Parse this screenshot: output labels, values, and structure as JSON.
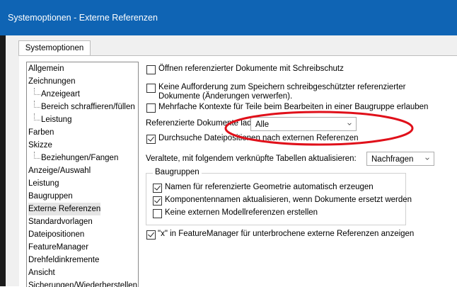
{
  "window": {
    "title": "Systemoptionen - Externe Referenzen"
  },
  "tabs": [
    {
      "label": "Systemoptionen"
    }
  ],
  "tree": {
    "items": [
      {
        "label": "Allgemein"
      },
      {
        "label": "Zeichnungen"
      },
      {
        "label": "Anzeigeart"
      },
      {
        "label": "Bereich schraffieren/füllen"
      },
      {
        "label": "Leistung"
      },
      {
        "label": "Farben"
      },
      {
        "label": "Skizze"
      },
      {
        "label": "Beziehungen/Fangen"
      },
      {
        "label": "Anzeige/Auswahl"
      },
      {
        "label": "Leistung"
      },
      {
        "label": "Baugruppen"
      },
      {
        "label": "Externe Referenzen"
      },
      {
        "label": "Standardvorlagen"
      },
      {
        "label": "Dateipositionen"
      },
      {
        "label": "FeatureManager"
      },
      {
        "label": "Drehfeldinkremente"
      },
      {
        "label": "Ansicht"
      },
      {
        "label": "Sicherungen/Wiederherstellen"
      }
    ],
    "selected": "Externe Referenzen"
  },
  "options": {
    "open_readonly": {
      "label": "Öffnen referenzierter Dokumente mit Schreibschutz",
      "checked": false
    },
    "no_prompt_line1": {
      "label": "Keine Aufforderung zum Speichern schreibgeschützter referenzierter",
      "checked": false
    },
    "no_prompt_line2": "Dokumente (Änderungen verwerfen).",
    "multi_context": {
      "label": "Mehrfache Kontexte für Teile beim Bearbeiten in einer Baugruppe erlauben",
      "checked": false
    },
    "load_label": "Referenzierte Dokumente laden:",
    "load_value": "Alle",
    "search_positions": {
      "label": "Durchsuche Dateipositionen nach externen Referenzen",
      "checked": true
    },
    "update_label": "Veraltete, mit folgendem verknüpfte Tabellen aktualisieren:",
    "update_value": "Nachfragen",
    "group_title": "Baugruppen",
    "auto_names": {
      "label": "Namen für referenzierte Geometrie automatisch erzeugen",
      "checked": true
    },
    "update_component_names": {
      "label": "Komponentennamen aktualisieren, wenn Dokumente ersetzt werden",
      "checked": true
    },
    "no_external_model": {
      "label": "Keine externen Modellreferenzen erstellen",
      "checked": false
    },
    "show_x": {
      "label": "\"x\" in FeatureManager für unterbrochene externe Referenzen anzeigen",
      "checked": true
    }
  },
  "colors": {
    "titlebar": "#0f64b4",
    "annotation_circle": "#e0101a"
  }
}
